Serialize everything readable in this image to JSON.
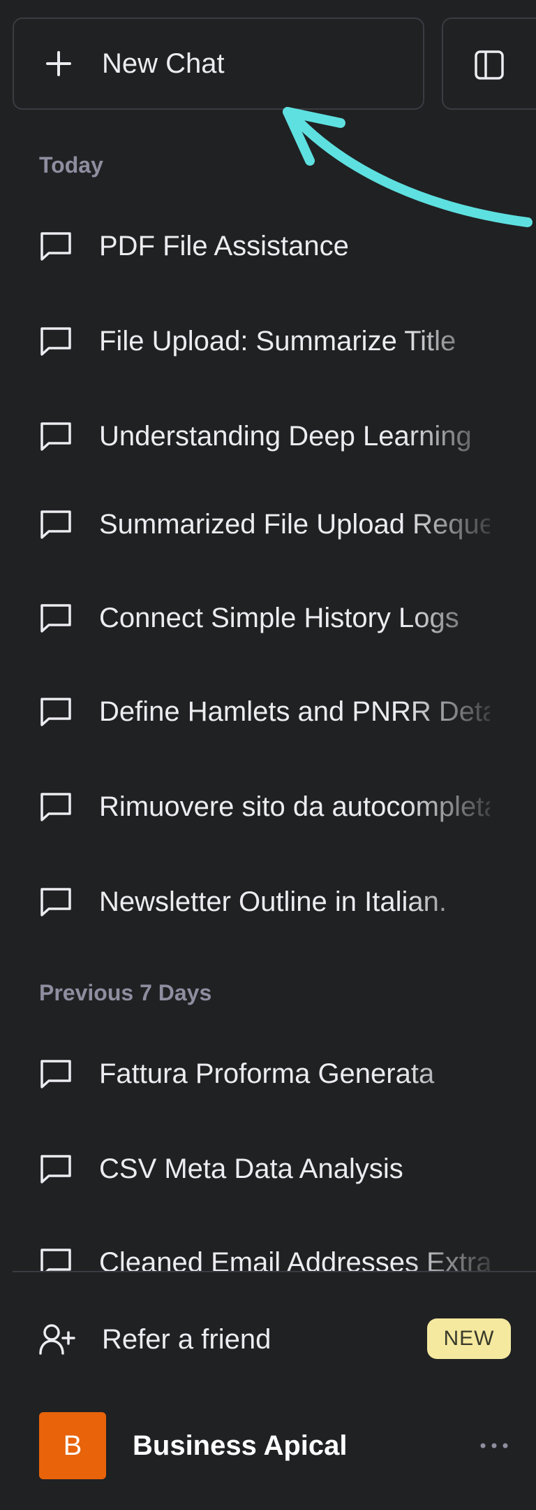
{
  "header": {
    "new_chat_label": "New Chat"
  },
  "sections": [
    {
      "label": "Today",
      "items": [
        "PDF File Assistance",
        "File Upload: Summarize Title",
        "Understanding Deep Learning",
        "Summarized File Upload Request",
        "Connect Simple History Logs",
        "Define Hamlets and PNRR Details",
        "Rimuovere sito da autocompletamento",
        "Newsletter Outline in Italian."
      ]
    },
    {
      "label": "Previous 7 Days",
      "items": [
        "Fattura Proforma Generata",
        "CSV Meta Data Analysis",
        "Cleaned Email Addresses Extracted"
      ]
    }
  ],
  "footer": {
    "refer_label": "Refer a friend",
    "new_badge": "NEW",
    "account_initial": "B",
    "account_name": "Business Apical"
  },
  "colors": {
    "background": "#202123",
    "border": "#3b3c43",
    "text": "#ececf1",
    "section_label": "#8e8ea0",
    "badge_bg": "#f5e9a0",
    "avatar_bg": "#e8630a",
    "annotation_arrow": "#5ee0e0"
  }
}
